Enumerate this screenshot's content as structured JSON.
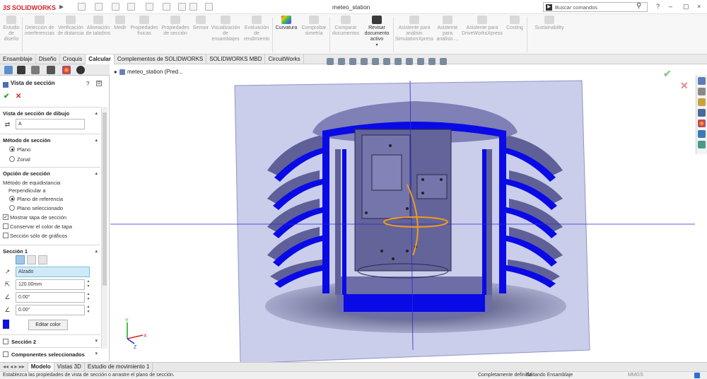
{
  "app": {
    "brand_ds": "3S",
    "brand_name": "SOLIDWORKS",
    "document_title": "meteo_station"
  },
  "search": {
    "placeholder": "Buscar comandos"
  },
  "window_controls": {
    "help": "?",
    "minimize": "–",
    "restore": "▢",
    "close": "×"
  },
  "ribbon": {
    "buttons": [
      {
        "label": "Estudio de diseño",
        "enabled": false
      },
      {
        "label": "Detección de interferencias",
        "enabled": false
      },
      {
        "label": "Verificación de distancia",
        "enabled": false
      },
      {
        "label": "Alineación de taladros",
        "enabled": false
      },
      {
        "label": "Medir",
        "enabled": false
      },
      {
        "label": "Propiedades físicas",
        "enabled": false
      },
      {
        "label": "Propiedades de sección",
        "enabled": false
      },
      {
        "label": "Sensor",
        "enabled": false
      },
      {
        "label": "Visualización de ensamblajes",
        "enabled": false
      },
      {
        "label": "Evaluación de rendimiento",
        "enabled": false
      },
      {
        "label": "Curvatura",
        "enabled": true
      },
      {
        "label": "Comprobar simetría",
        "enabled": false
      },
      {
        "label": "Comparar documentos",
        "enabled": false
      },
      {
        "label": "Revisar documento activo",
        "enabled": true
      },
      {
        "label": "Asistente para análisis SimulationXpress",
        "enabled": false
      },
      {
        "label": "Asistente para análisis ...",
        "enabled": false
      },
      {
        "label": "Asistente para DriveWorksXpress",
        "enabled": false
      },
      {
        "label": "Costing",
        "enabled": false
      },
      {
        "label": "Sustainability",
        "enabled": false
      }
    ]
  },
  "command_tabs": [
    "Ensamblaje",
    "Diseño",
    "Croquis",
    "Calcular",
    "Complementos de SOLIDWORKS",
    "SOLIDWORKS MBD",
    "CircuitWorks"
  ],
  "active_command_tab": "Calcular",
  "property_manager": {
    "title": "Vista de sección",
    "group_drawing": {
      "title": "Vista de sección de dibujo",
      "label_value": "A"
    },
    "group_method": {
      "title": "Método de sección",
      "options": [
        "Plano",
        "Zonal"
      ],
      "selected": "Plano"
    },
    "group_options": {
      "title": "Opción de sección",
      "equidistance_label": "Método de equidistancia",
      "perpendicular_label": "Perpendicular a",
      "perp_options": [
        "Plano de referencia",
        "Plano seleccionado"
      ],
      "perp_selected": "Plano de referencia",
      "checkboxes": [
        {
          "label": "Mostrar tapa de sección",
          "checked": true
        },
        {
          "label": "Conservar el color de tapa",
          "checked": false
        },
        {
          "label": "Sección sólo de gráficos",
          "checked": false
        }
      ]
    },
    "group_section1": {
      "title": "Sección 1",
      "plane": "Alzado",
      "offset": "120.00mm",
      "angle_x": "0.00°",
      "angle_y": "0.00°",
      "edit_color": "Editar color",
      "cap_color": "#1010e0"
    },
    "group_section2": {
      "title": "Sección 2"
    },
    "group_components": {
      "title": "Componentes seleccionados"
    }
  },
  "feature_tree": {
    "root": "meteo_station  (Pred..."
  },
  "bottom_tabs": [
    "Modelo",
    "Vistas 3D",
    "Estudio de movimiento 1"
  ],
  "active_bottom_tab": "Modelo",
  "status": {
    "message": "Establezca las propiedades de vista de sección o arrastre el plano de sección.",
    "definition": "Completamente definida",
    "mode": "Editando Ensamblaje",
    "units": "MMGS"
  },
  "colors": {
    "section_blue": "#0a0ae6",
    "body_lavender": "#7f80b5",
    "plane_tint": "#b8bde4",
    "accent_orange": "#f39a1f"
  }
}
